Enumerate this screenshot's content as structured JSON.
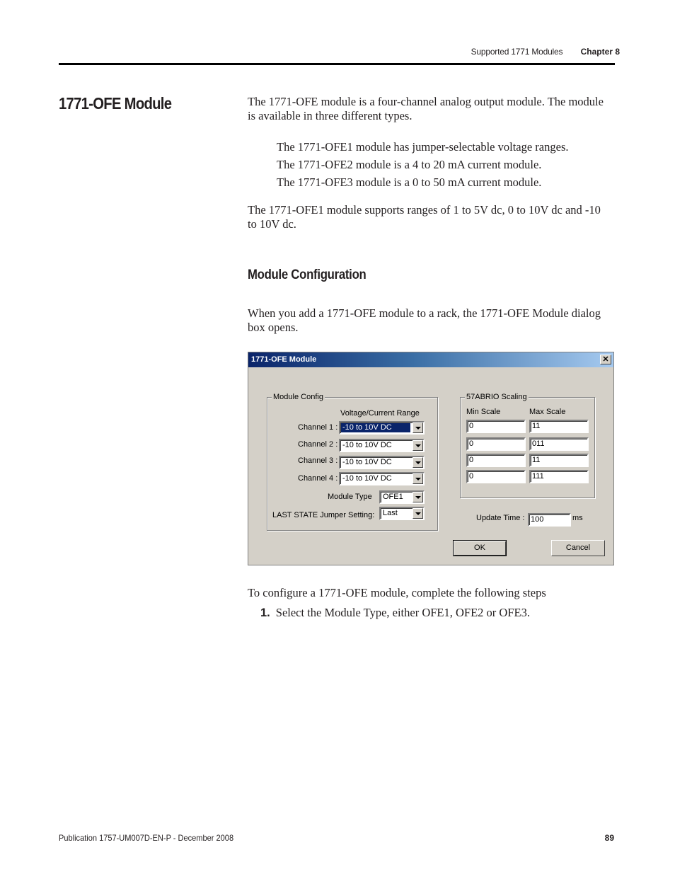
{
  "header": {
    "section_label": "Supported 1771 Modules",
    "chapter_label": "Chapter 8"
  },
  "section_title": "1771-OFE Module",
  "intro_paragraph": "The 1771-OFE module is a four-channel analog output module. The module is available in three different types.",
  "module_types": [
    "The 1771-OFE1 module has jumper-selectable voltage ranges.",
    "The 1771-OFE2 module is a 4 to 20 mA current module.",
    "The 1771-OFE3 module is a 0 to 50 mA current module."
  ],
  "ranges_paragraph": "The 1771-OFE1 module supports ranges of 1 to 5V dc, 0 to 10V dc and -10 to 10V dc.",
  "subheading": "Module Configuration",
  "config_paragraph": "When you add a 1771-OFE module to a rack, the 1771-OFE Module dialog box opens.",
  "dialog": {
    "title": "1771-OFE Module",
    "close_glyph": "✕",
    "module_config": {
      "group_label": "Module Config",
      "column_header": "Voltage/Current Range",
      "channels": [
        {
          "label": "Channel 1 :",
          "value": "-10 to 10V DC"
        },
        {
          "label": "Channel 2 :",
          "value": "-10 to 10V DC"
        },
        {
          "label": "Channel 3 :",
          "value": "-10 to 10V DC"
        },
        {
          "label": "Channel 4 :",
          "value": "-10 to 10V DC"
        }
      ],
      "module_type_label": "Module Type",
      "module_type_value": "OFE1",
      "last_state_label": "LAST STATE Jumper Setting:",
      "last_state_value": "Last"
    },
    "scaling": {
      "group_label": "57ABRIO Scaling",
      "min_header": "Min Scale",
      "max_header": "Max Scale",
      "rows": [
        {
          "min": "0",
          "max": "11"
        },
        {
          "min": "0",
          "max": "011"
        },
        {
          "min": "0",
          "max": "11"
        },
        {
          "min": "0",
          "max": "111"
        }
      ]
    },
    "update_time_label": "Update Time :",
    "update_time_value": "100",
    "update_time_unit": "ms",
    "ok_label": "OK",
    "cancel_label": "Cancel"
  },
  "steps_intro": "To configure a 1771-OFE module, complete the following steps",
  "steps": [
    {
      "number": "1.",
      "text": "Select the Module Type, either OFE1, OFE2 or OFE3."
    }
  ],
  "footer": {
    "publication": "Publication 1757-UM007D-EN-P - December 2008",
    "page_number": "89"
  }
}
